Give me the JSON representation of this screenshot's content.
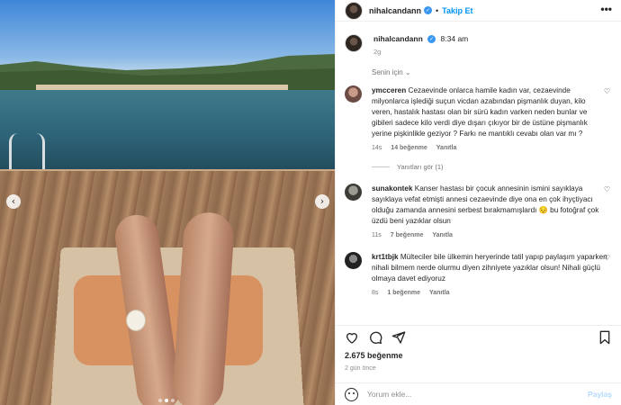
{
  "post": {
    "username": "nihalcandann",
    "follow_label": "Takip Et",
    "separator": "•",
    "more": "•••",
    "caption_time": "8:34 am",
    "caption_age": "2g",
    "sort_label": "Senin için"
  },
  "comments": [
    {
      "username": "ymcceren",
      "text": "Cezaevinde onlarca hamile kadın var, cezaevinde milyonlarca işlediği suçun vicdan azabından pişmanlık duyan, kilo veren, hastalık hastası olan bir sürü kadın varken neden bunlar ve gibileri sadece kilo verdi diye dışarı çıkıyor bir de üstüne pişmanlık yerine pişkinlikle geziyor ? Farkı ne mantıklı cevabı olan var mı ?",
      "age": "14s",
      "likes": "14 beğenme",
      "reply": "Yanıtla",
      "replies_label": "Yanıtları gör (1)"
    },
    {
      "username": "sunakontek",
      "text": "Kanser hastası bir çocuk annesinin ismini sayıklaya sayıklaya vefat etmişti annesi cezaevinde diye ona en çok ihyçtiyacı olduğu zamanda annesini serbest bırakmamışlardı 😔 bu fotoğraf çok üzdü beni yazıklar olsun",
      "age": "11s",
      "likes": "7 beğenme",
      "reply": "Yanıtla"
    },
    {
      "username": "krt1tbjk",
      "text": "Mülteciler bile ülkemin heryerinde tatil yapıp paylaşım yaparken nihali bilmem nerde olurmu diyen zihniyete yazıklar olsun! Nihali güçlü olmaya davet ediyoruz",
      "age": "8s",
      "likes": "1 beğenme",
      "reply": "Yanıtla"
    }
  ],
  "footer": {
    "likes_total": "2.675 beğenme",
    "age": "2 gün önce",
    "comment_placeholder": "Yorum ekle...",
    "post_label": "Paylaş"
  },
  "icons": {
    "heart": "heart-icon",
    "comment": "comment-icon",
    "share": "share-icon",
    "bookmark": "bookmark-icon",
    "emoji": "emoji-icon",
    "verified": "verified-badge-icon",
    "prev": "chevron-left-icon",
    "next": "chevron-right-icon"
  },
  "colors": {
    "accent": "#0095f6",
    "verified": "#3897f0",
    "muted": "#8e8e8e"
  },
  "carousel": {
    "total": 3,
    "active": 2
  }
}
